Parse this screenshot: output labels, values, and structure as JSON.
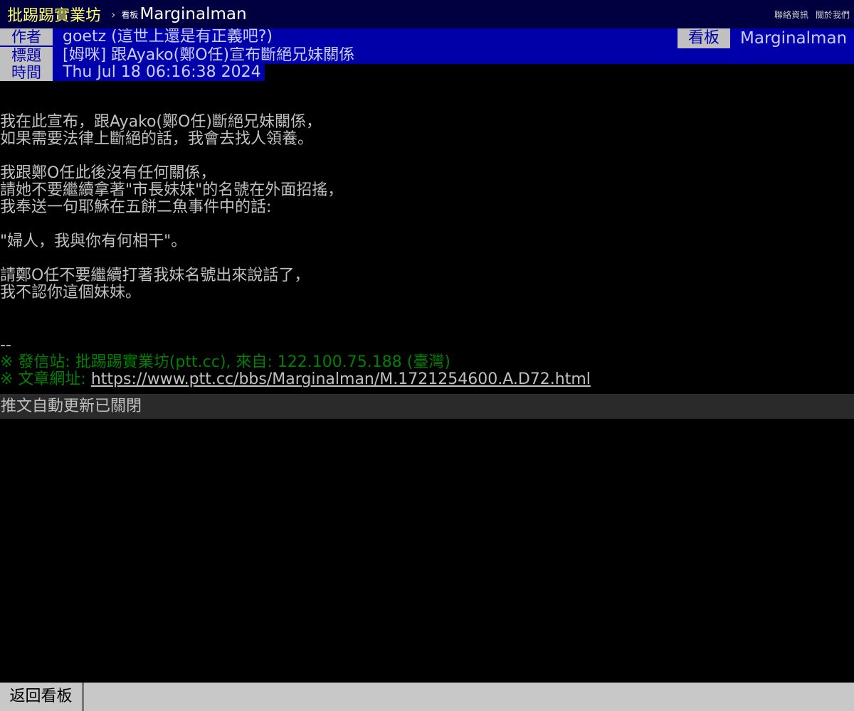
{
  "topbar": {
    "site_name": "批踢踢實業坊",
    "separator": "›",
    "board_prefix": "看板",
    "board_name": "Marginalman",
    "links": [
      "聯絡資訊",
      "關於我們"
    ]
  },
  "meta": {
    "author_tag": "作者",
    "author": "goetz (這世上還是有正義吧?)",
    "board_tag": "看板",
    "board": "Marginalman",
    "title_tag": "標題",
    "title": "[姆咪] 跟Ayako(鄭O任)宣布斷絕兄妹關係",
    "time_tag": "時間",
    "time": "Thu Jul 18 06:16:38 2024"
  },
  "content": {
    "lines": [
      "我在此宣布，跟Ayako(鄭O任)斷絕兄妹關係，",
      "如果需要法律上斷絕的話，我會去找人領養。",
      "",
      "我跟鄭O任此後沒有任何關係，",
      "請她不要繼續拿著\"市長妹妹\"的名號在外面招搖，",
      "我奉送一句耶穌在五餅二魚事件中的話:",
      "",
      "\"婦人，我與你有何相干\"。",
      "",
      "請鄭O任不要繼續打著我妹名號出來說話了，",
      "我不認你這個妹妹。"
    ]
  },
  "signature": {
    "dash": "--",
    "origin": "※ 發信站: 批踢踢實業坊(ptt.cc), 來自: 122.100.75.188 (臺灣)",
    "url_label": "※ 文章網址: ",
    "url": "https://www.ptt.cc/bbs/Marginalman/M.1721254600.A.D72.html"
  },
  "push_notice": "推文自動更新已關閉",
  "bottombar": {
    "back_label": "返回看板"
  },
  "colors": {
    "topbar_bg": "#000040",
    "brand": "#ffff66",
    "meta_bg": "#0000aa",
    "meta_tag_bg": "#c0c0c0",
    "body_text": "#c0c0c0",
    "signature_green": "#008000"
  }
}
